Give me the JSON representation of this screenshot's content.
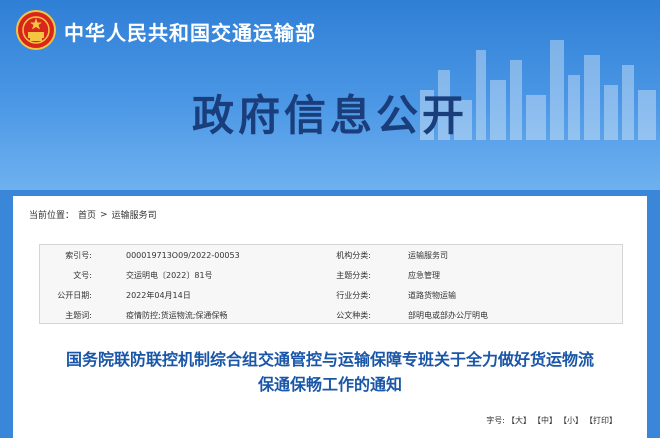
{
  "header": {
    "ministry_name": "中华人民共和国交通运输部",
    "banner_title": "政府信息公开"
  },
  "breadcrumb": {
    "prefix": "当前位置：",
    "items": [
      "首页",
      "运输服务司"
    ],
    "separator": ">"
  },
  "meta": {
    "rows": [
      {
        "l1": "索引号:",
        "v1": "000019713O09/2022-00053",
        "l2": "机构分类:",
        "v2": "运输服务司"
      },
      {
        "l1": "文号:",
        "v1": "交运明电〔2022〕81号",
        "l2": "主题分类:",
        "v2": "应急管理"
      },
      {
        "l1": "公开日期:",
        "v1": "2022年04月14日",
        "l2": "行业分类:",
        "v2": "道路货物运输"
      },
      {
        "l1": "主题词:",
        "v1": "疫情防控;货运物流;保通保畅",
        "l2": "公文种类:",
        "v2": "部明电或部办公厅明电"
      }
    ]
  },
  "document": {
    "title_line1": "国务院联防联控机制综合组交通管控与运输保障专班关于全力做好货运物流",
    "title_line2": "保通保畅工作的通知"
  },
  "font_size": {
    "label": "字号:",
    "large": "【大】",
    "medium": "【中】",
    "small": "【小】",
    "print": "【打印】"
  },
  "colors": {
    "banner": "#3a86d9",
    "title_blue": "#1a56a8",
    "banner_title": "#1a3d7c"
  }
}
